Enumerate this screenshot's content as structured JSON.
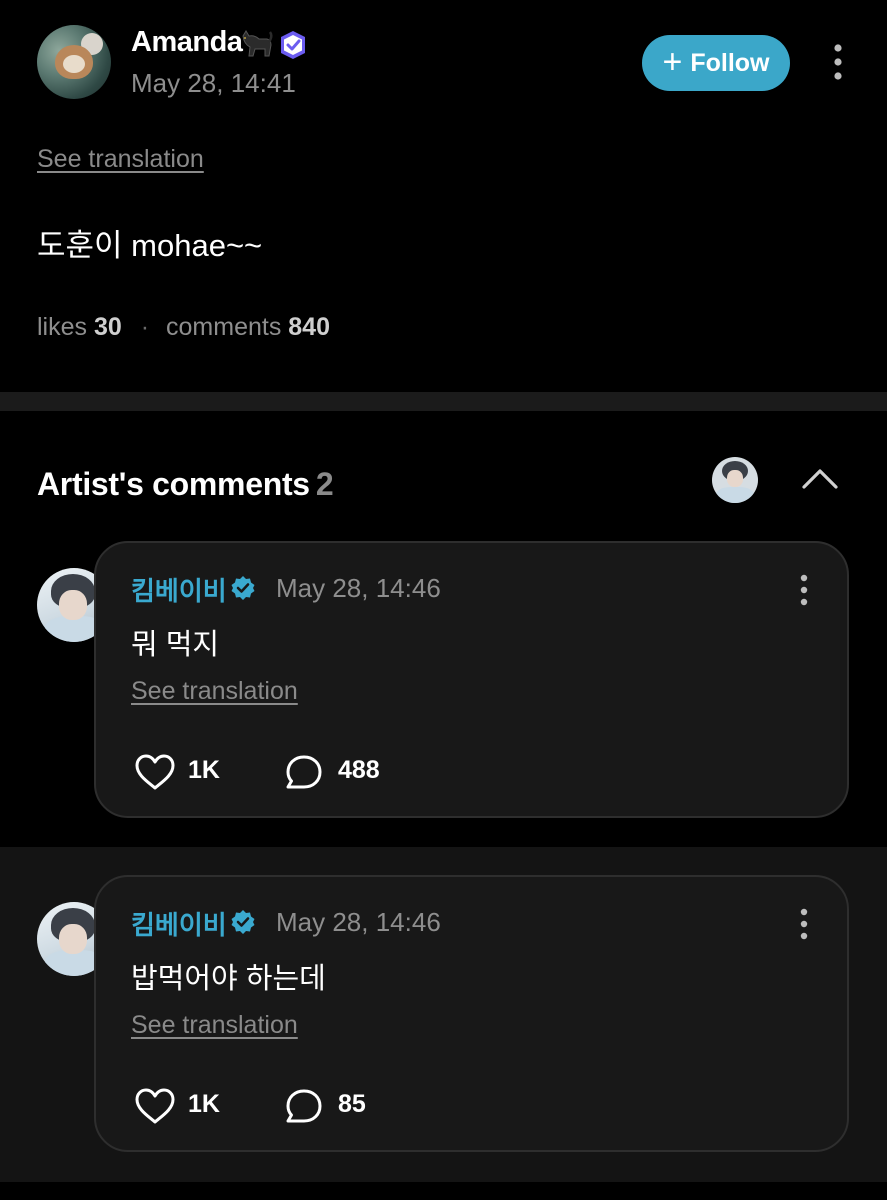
{
  "post": {
    "author": "Amanda",
    "author_icons": [
      "black-cat-icon",
      "verified-purple-icon"
    ],
    "timestamp": "May 28, 14:41",
    "follow_label": "Follow",
    "see_translation": "See translation",
    "body": "도훈이 mohae~~",
    "stats": {
      "likes_label": "likes",
      "likes_value": "30",
      "comments_label": "comments",
      "comments_value": "840"
    }
  },
  "artist_comments": {
    "title": "Artist's comments",
    "count": "2",
    "items": [
      {
        "author": "킴베이비",
        "timestamp": "May 28, 14:46",
        "text": "뭐 먹지",
        "see_translation": "See translation",
        "likes": "1K",
        "replies": "488"
      },
      {
        "author": "킴베이비",
        "timestamp": "May 28, 14:46",
        "text": "밥먹어야 하는데",
        "see_translation": "See translation",
        "likes": "1K",
        "replies": "85"
      }
    ]
  },
  "colors": {
    "accent": "#3ba7c9",
    "artist_name": "#3aa9cf",
    "background": "#000000",
    "card": "#181818",
    "muted_text": "#8e8e8e"
  }
}
